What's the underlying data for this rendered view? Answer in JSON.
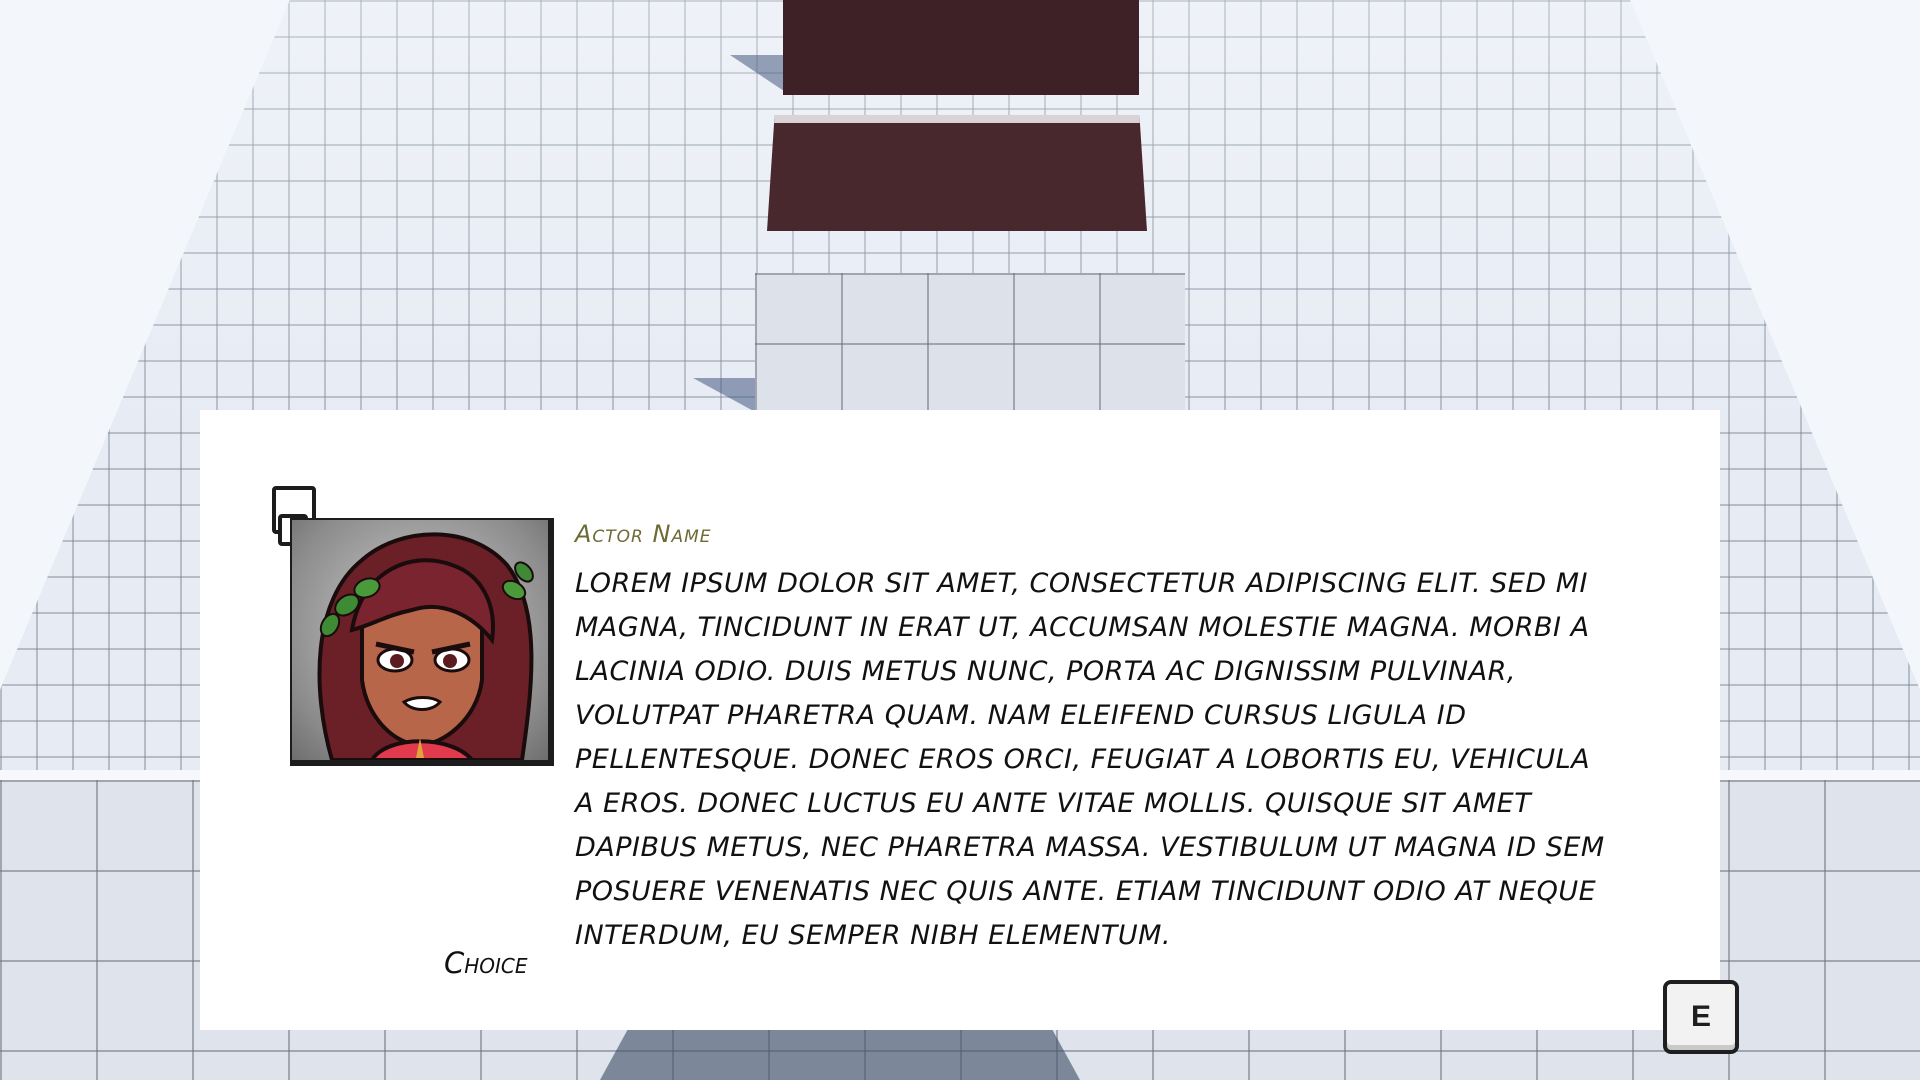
{
  "dialogue": {
    "actor_name": "Actor Name",
    "text": "Lorem ipsum dolor sit amet, consectetur adipiscing elit. Sed mi magna, tincidunt in erat ut, accumsan molestie magna. Morbi a lacinia odio. Duis metus nunc, porta ac dignissim pulvinar, volutpat pharetra quam. Nam eleifend cursus ligula id pellentesque. Donec eros orci, feugiat a lobortis eu, vehicula a eros. Donec luctus eu ante vitae mollis. Quisque sit amet dapibus metus, nec pharetra massa. Vestibulum ut magna id sem posuere venenatis nec quis ante. Etiam tincidunt odio at neque interdum, eu semper nibh elementum.",
    "choices": [
      "Choice"
    ],
    "continue_key": "E",
    "portrait_icon": "character-portrait-icon"
  },
  "colors": {
    "actor_name": "#6d6a35",
    "panel": "#ffffff",
    "text": "#111111"
  }
}
